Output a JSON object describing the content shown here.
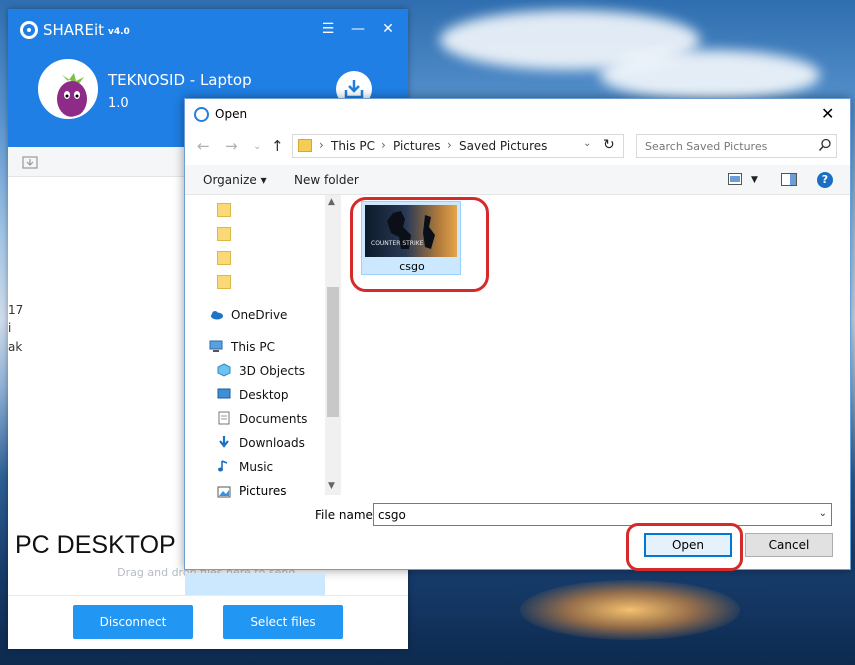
{
  "shareit": {
    "app_name": "SHAREit",
    "app_version": "v4.0",
    "device_name": "TEKNOSID - Laptop",
    "device_version": "1.0",
    "left_fragments": [
      "17",
      "i",
      "ak"
    ],
    "pc_desktop_label": "PC DESKTOP",
    "drag_hint": "Drag and drop files here to send.",
    "disconnect_label": "Disconnect",
    "select_files_label": "Select files",
    "accent_color": "#1f7fe4",
    "button_color": "#2196f3"
  },
  "dialog": {
    "title": "Open",
    "breadcrumb": [
      "This PC",
      "Pictures",
      "Saved Pictures"
    ],
    "search_placeholder": "Search Saved Pictures",
    "organize_label": "Organize",
    "new_folder_label": "New folder",
    "nav_items": [
      {
        "label": "OneDrive",
        "icon": "cloud-icon"
      },
      {
        "label": "This PC",
        "icon": "computer-icon"
      },
      {
        "label": "3D Objects",
        "icon": "cube-icon"
      },
      {
        "label": "Desktop",
        "icon": "desktop-icon"
      },
      {
        "label": "Documents",
        "icon": "document-icon"
      },
      {
        "label": "Downloads",
        "icon": "download-icon"
      },
      {
        "label": "Music",
        "icon": "music-icon"
      },
      {
        "label": "Pictures",
        "icon": "pictures-icon"
      }
    ],
    "selected_nav": "Pictures",
    "files": [
      {
        "name": "csgo",
        "thumbnail_text": "COUNTER STRIKE"
      }
    ],
    "file_name_label": "File name:",
    "file_name_value": "csgo",
    "open_label": "Open",
    "cancel_label": "Cancel",
    "highlight_color": "#d62a2a"
  }
}
